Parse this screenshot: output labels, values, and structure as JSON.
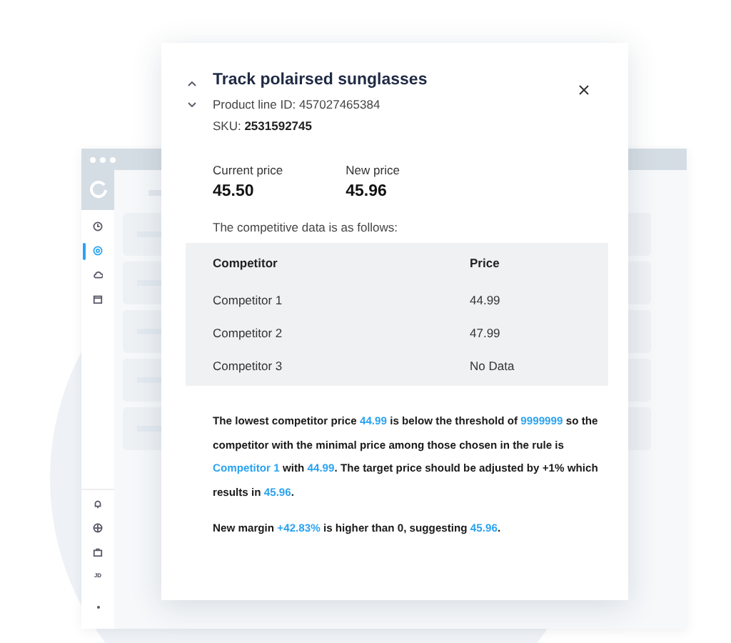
{
  "backdrop": {
    "sidebar": {
      "top_items": [
        {
          "kind": "clock",
          "selected": false
        },
        {
          "kind": "target",
          "selected": true
        },
        {
          "kind": "cloud",
          "selected": false
        },
        {
          "kind": "calendar",
          "selected": false
        }
      ],
      "bottom_items": [
        {
          "kind": "bell"
        },
        {
          "kind": "globe"
        },
        {
          "kind": "briefcase"
        }
      ],
      "initials": "JD"
    }
  },
  "modal": {
    "title": "Track polairsed sunglasses",
    "product_line": "Product line ID: 457027465384",
    "sku": "SKU: **2531592745**",
    "prices": [
      {
        "label": "Current price",
        "value": "45.50"
      },
      {
        "label": "New price",
        "value": "45.96"
      }
    ],
    "intro": "The competitive data is as follows:",
    "table": {
      "columns": [
        "Competitor",
        "Price"
      ],
      "rows": [
        [
          "Competitor 1",
          "44.99"
        ],
        [
          "Competitor 2",
          "47.99"
        ],
        [
          "Competitor 3",
          "No Data"
        ]
      ]
    },
    "paragraphs": [
      [
        {
          "text": "The lowest competitor price ",
          "highlight": false
        },
        {
          "text": "44.99",
          "highlight": true
        },
        {
          "text": " is below the threshold of ",
          "highlight": false
        },
        {
          "text": "9999999",
          "highlight": true
        },
        {
          "text": " so the competitor with the minimal price among those chosen in the rule is ",
          "highlight": false
        },
        {
          "text": "Competitor 1",
          "highlight": true
        },
        {
          "text": " with ",
          "highlight": false
        },
        {
          "text": "44.99",
          "highlight": true
        },
        {
          "text": ". The target price should be adjusted by +1% which results in ",
          "highlight": false
        },
        {
          "text": "45.96",
          "highlight": true
        },
        {
          "text": ".",
          "highlight": false
        }
      ],
      [
        {
          "text": "New margin ",
          "highlight": false
        },
        {
          "text": "+42.83%",
          "highlight": true
        },
        {
          "text": " is higher than 0, suggesting ",
          "highlight": false
        },
        {
          "text": "45.96",
          "highlight": true
        },
        {
          "text": ".",
          "highlight": false
        }
      ]
    ]
  }
}
